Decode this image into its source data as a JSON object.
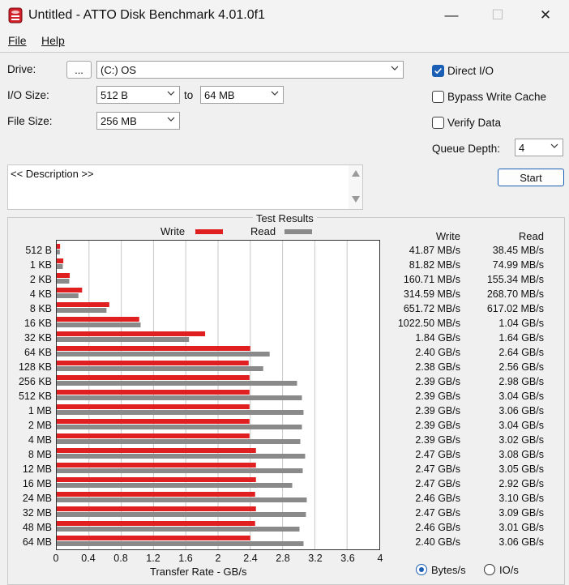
{
  "window": {
    "title": "Untitled - ATTO Disk Benchmark 4.01.0f1",
    "minimize_glyph": "—",
    "maximize_glyph": "☐",
    "close_glyph": "✕"
  },
  "menu": {
    "file": "File",
    "help": "Help"
  },
  "form": {
    "drive_label": "Drive:",
    "browse_label": "...",
    "drive_value": "(C:) OS",
    "io_size_label": "I/O Size:",
    "io_from": "512 B",
    "to_label": "to",
    "io_to": "64 MB",
    "file_size_label": "File Size:",
    "file_size": "256 MB",
    "direct_io_label": "Direct I/O",
    "direct_io_checked": true,
    "bypass_label": "Bypass Write Cache",
    "bypass_checked": false,
    "verify_label": "Verify Data",
    "verify_checked": false,
    "queue_depth_label": "Queue Depth:",
    "queue_depth": "4",
    "start_label": "Start",
    "description": "<< Description >>"
  },
  "results": {
    "heading": "Test Results",
    "legend_write": "Write",
    "legend_read": "Read",
    "col_write": "Write",
    "col_read": "Read",
    "units_bytes": "Bytes/s",
    "units_io": "IO/s",
    "units_selected": "Bytes/s"
  },
  "colors": {
    "write": "#e02020",
    "read": "#8a8a8a",
    "accent": "#1a5fb4"
  },
  "chart_data": {
    "type": "bar",
    "orientation": "horizontal",
    "title": "Test Results",
    "xlabel": "Transfer Rate - GB/s",
    "xlim": [
      0,
      4
    ],
    "xticks": [
      "0",
      "0.4",
      "0.8",
      "1.2",
      "1.6",
      "2",
      "2.4",
      "2.8",
      "3.2",
      "3.6",
      "4"
    ],
    "grid": true,
    "legend": "top",
    "categories": [
      "512 B",
      "1 KB",
      "2 KB",
      "4 KB",
      "8 KB",
      "16 KB",
      "32 KB",
      "64 KB",
      "128 KB",
      "256 KB",
      "512 KB",
      "1 MB",
      "2 MB",
      "4 MB",
      "8 MB",
      "12 MB",
      "16 MB",
      "24 MB",
      "32 MB",
      "48 MB",
      "64 MB"
    ],
    "series": [
      {
        "name": "Write",
        "values": [
          0.04187,
          0.08182,
          0.16071,
          0.31459,
          0.65172,
          1.0225,
          1.84,
          2.4,
          2.38,
          2.39,
          2.39,
          2.39,
          2.39,
          2.39,
          2.47,
          2.47,
          2.47,
          2.46,
          2.47,
          2.46,
          2.4
        ],
        "labels": [
          "41.87 MB/s",
          "81.82 MB/s",
          "160.71 MB/s",
          "314.59 MB/s",
          "651.72 MB/s",
          "1022.50 MB/s",
          "1.84 GB/s",
          "2.40 GB/s",
          "2.38 GB/s",
          "2.39 GB/s",
          "2.39 GB/s",
          "2.39 GB/s",
          "2.39 GB/s",
          "2.39 GB/s",
          "2.47 GB/s",
          "2.47 GB/s",
          "2.47 GB/s",
          "2.46 GB/s",
          "2.47 GB/s",
          "2.46 GB/s",
          "2.40 GB/s"
        ]
      },
      {
        "name": "Read",
        "values": [
          0.03845,
          0.07499,
          0.15534,
          0.2687,
          0.61702,
          1.04,
          1.64,
          2.64,
          2.56,
          2.98,
          3.04,
          3.06,
          3.04,
          3.02,
          3.08,
          3.05,
          2.92,
          3.1,
          3.09,
          3.01,
          3.06
        ],
        "labels": [
          "38.45 MB/s",
          "74.99 MB/s",
          "155.34 MB/s",
          "268.70 MB/s",
          "617.02 MB/s",
          "1.04 GB/s",
          "1.64 GB/s",
          "2.64 GB/s",
          "2.56 GB/s",
          "2.98 GB/s",
          "3.04 GB/s",
          "3.06 GB/s",
          "3.04 GB/s",
          "3.02 GB/s",
          "3.08 GB/s",
          "3.05 GB/s",
          "2.92 GB/s",
          "3.10 GB/s",
          "3.09 GB/s",
          "3.01 GB/s",
          "3.06 GB/s"
        ]
      }
    ]
  }
}
